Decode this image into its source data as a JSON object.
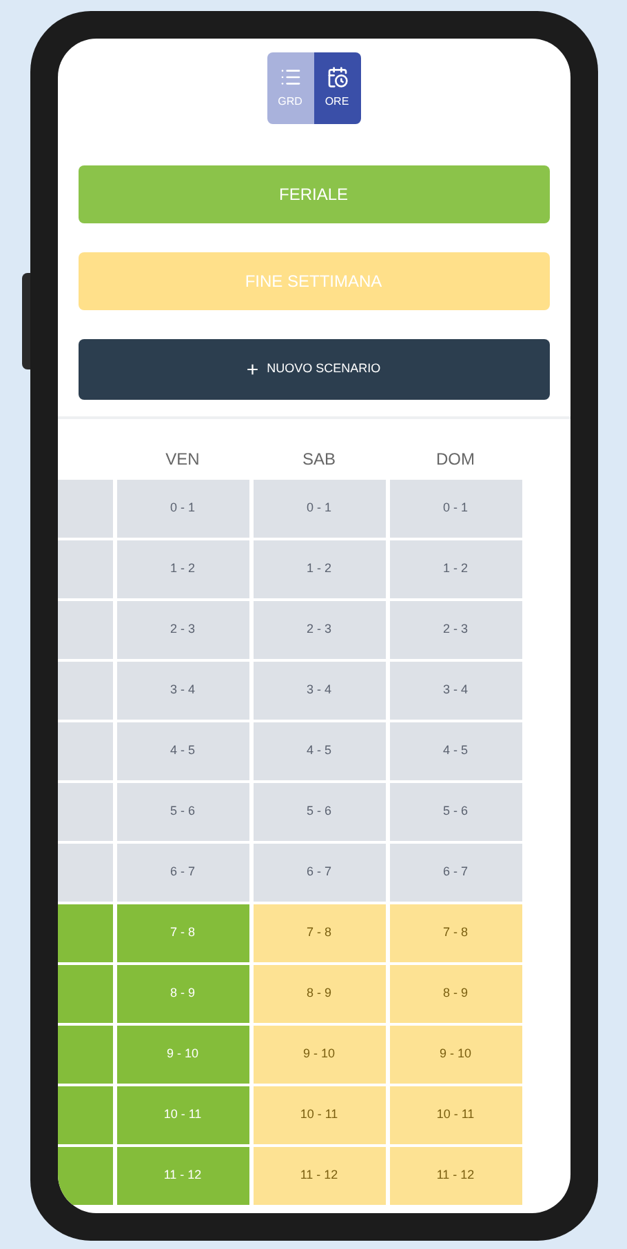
{
  "view_toggle": [
    {
      "label": "GRD",
      "selected": false
    },
    {
      "label": "ORE",
      "selected": true
    }
  ],
  "scenarios": [
    {
      "label": "FERIALE",
      "color": "#8bc34a"
    },
    {
      "label": "FINE SETTIMANA",
      "color": "#ffe08a"
    }
  ],
  "new_scenario_button": {
    "symbol": "+",
    "label": "NUOVO SCENARIO"
  },
  "grid": {
    "columns": [
      "VEN",
      "SAB",
      "DOM"
    ],
    "rows": [
      {
        "cells": [
          {
            "text": "0 - 1",
            "kind": "off"
          },
          {
            "text": "0 - 1",
            "kind": "off"
          },
          {
            "text": "0 - 1",
            "kind": "off"
          }
        ]
      },
      {
        "cells": [
          {
            "text": "1 - 2",
            "kind": "off"
          },
          {
            "text": "1 - 2",
            "kind": "off"
          },
          {
            "text": "1 - 2",
            "kind": "off"
          }
        ]
      },
      {
        "cells": [
          {
            "text": "2 - 3",
            "kind": "off"
          },
          {
            "text": "2 - 3",
            "kind": "off"
          },
          {
            "text": "2 - 3",
            "kind": "off"
          }
        ]
      },
      {
        "cells": [
          {
            "text": "3 - 4",
            "kind": "off"
          },
          {
            "text": "3 - 4",
            "kind": "off"
          },
          {
            "text": "3 - 4",
            "kind": "off"
          }
        ]
      },
      {
        "cells": [
          {
            "text": "4 - 5",
            "kind": "off"
          },
          {
            "text": "4 - 5",
            "kind": "off"
          },
          {
            "text": "4 - 5",
            "kind": "off"
          }
        ]
      },
      {
        "cells": [
          {
            "text": "5 - 6",
            "kind": "off"
          },
          {
            "text": "5 - 6",
            "kind": "off"
          },
          {
            "text": "5 - 6",
            "kind": "off"
          }
        ]
      },
      {
        "cells": [
          {
            "text": "6 - 7",
            "kind": "off"
          },
          {
            "text": "6 - 7",
            "kind": "off"
          },
          {
            "text": "6 - 7",
            "kind": "off"
          }
        ]
      },
      {
        "cells": [
          {
            "text": "7 - 8",
            "kind": "weekday"
          },
          {
            "text": "7 - 8",
            "kind": "weekend"
          },
          {
            "text": "7 - 8",
            "kind": "weekend"
          }
        ]
      },
      {
        "cells": [
          {
            "text": "8 - 9",
            "kind": "weekday"
          },
          {
            "text": "8 - 9",
            "kind": "weekend"
          },
          {
            "text": "8 - 9",
            "kind": "weekend"
          }
        ]
      },
      {
        "cells": [
          {
            "text": "9 - 10",
            "kind": "weekday"
          },
          {
            "text": "9 - 10",
            "kind": "weekend"
          },
          {
            "text": "9 - 10",
            "kind": "weekend"
          }
        ]
      },
      {
        "cells": [
          {
            "text": "10 - 11",
            "kind": "weekday"
          },
          {
            "text": "10 - 11",
            "kind": "weekend"
          },
          {
            "text": "10 - 11",
            "kind": "weekend"
          }
        ]
      },
      {
        "cells": [
          {
            "text": "11 - 12",
            "kind": "weekday"
          },
          {
            "text": "11 - 12",
            "kind": "weekend"
          },
          {
            "text": "11 - 12",
            "kind": "weekend"
          }
        ]
      }
    ]
  }
}
